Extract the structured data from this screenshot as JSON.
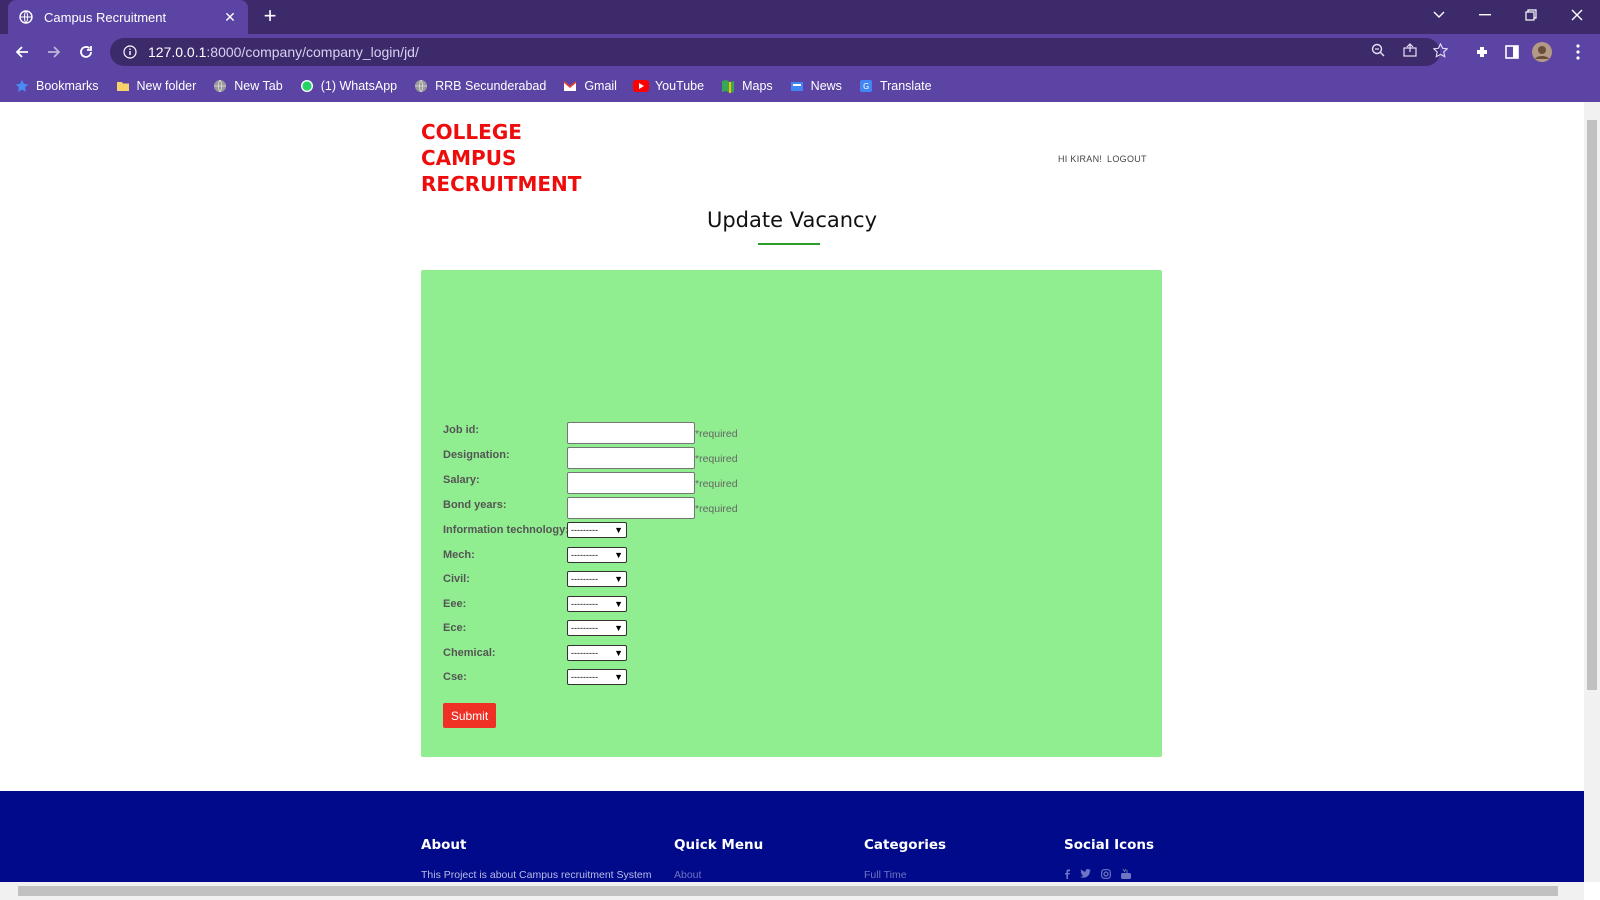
{
  "browser": {
    "tab_title": "Campus Recruitment",
    "url_host": "127.0.0.1",
    "url_path": ":8000/company/company_login/jd/",
    "bookmarks": [
      {
        "label": "Bookmarks",
        "icon": "star-icon"
      },
      {
        "label": "New folder",
        "icon": "folder-icon"
      },
      {
        "label": "New Tab",
        "icon": "globe-icon"
      },
      {
        "label": "(1) WhatsApp",
        "icon": "whatsapp-icon"
      },
      {
        "label": "RRB Secunderabad",
        "icon": "globe-icon"
      },
      {
        "label": "Gmail",
        "icon": "gmail-icon"
      },
      {
        "label": "YouTube",
        "icon": "youtube-icon"
      },
      {
        "label": "Maps",
        "icon": "maps-icon"
      },
      {
        "label": "News",
        "icon": "news-icon"
      },
      {
        "label": "Translate",
        "icon": "translate-icon"
      }
    ]
  },
  "header": {
    "brand_line1": "COLLEGE",
    "brand_line2": "CAMPUS",
    "brand_line3": "RECRUITMENT",
    "greeting": "HI KIRAN!",
    "logout": "LOGOUT"
  },
  "page": {
    "title": "Update Vacancy"
  },
  "form": {
    "required_text": "*required",
    "text_fields": [
      {
        "label": "Job id:",
        "value": ""
      },
      {
        "label": "Designation:",
        "value": ""
      },
      {
        "label": "Salary:",
        "value": ""
      },
      {
        "label": "Bond years:",
        "value": ""
      }
    ],
    "select_fields": [
      {
        "label": "Information technology:",
        "value": "---------"
      },
      {
        "label": "Mech:",
        "value": "---------"
      },
      {
        "label": "Civil:",
        "value": "---------"
      },
      {
        "label": "Eee:",
        "value": "---------"
      },
      {
        "label": "Ece:",
        "value": "---------"
      },
      {
        "label": "Chemical:",
        "value": "---------"
      },
      {
        "label": "Cse:",
        "value": "---------"
      }
    ],
    "submit_label": "Submit"
  },
  "footer": {
    "about_title": "About",
    "about_text": "This Project is about Campus recruitment System",
    "quick_menu_title": "Quick Menu",
    "quick_menu_first": "About",
    "categories_title": "Categories",
    "categories_first": "Full Time",
    "social_title": "Social Icons"
  },
  "colors": {
    "brand": "#ee0d0d",
    "form_bg": "#90ee90",
    "submit": "#ee3124",
    "footer_bg": "#000a8a",
    "browser_chrome": "#5b44a4"
  }
}
